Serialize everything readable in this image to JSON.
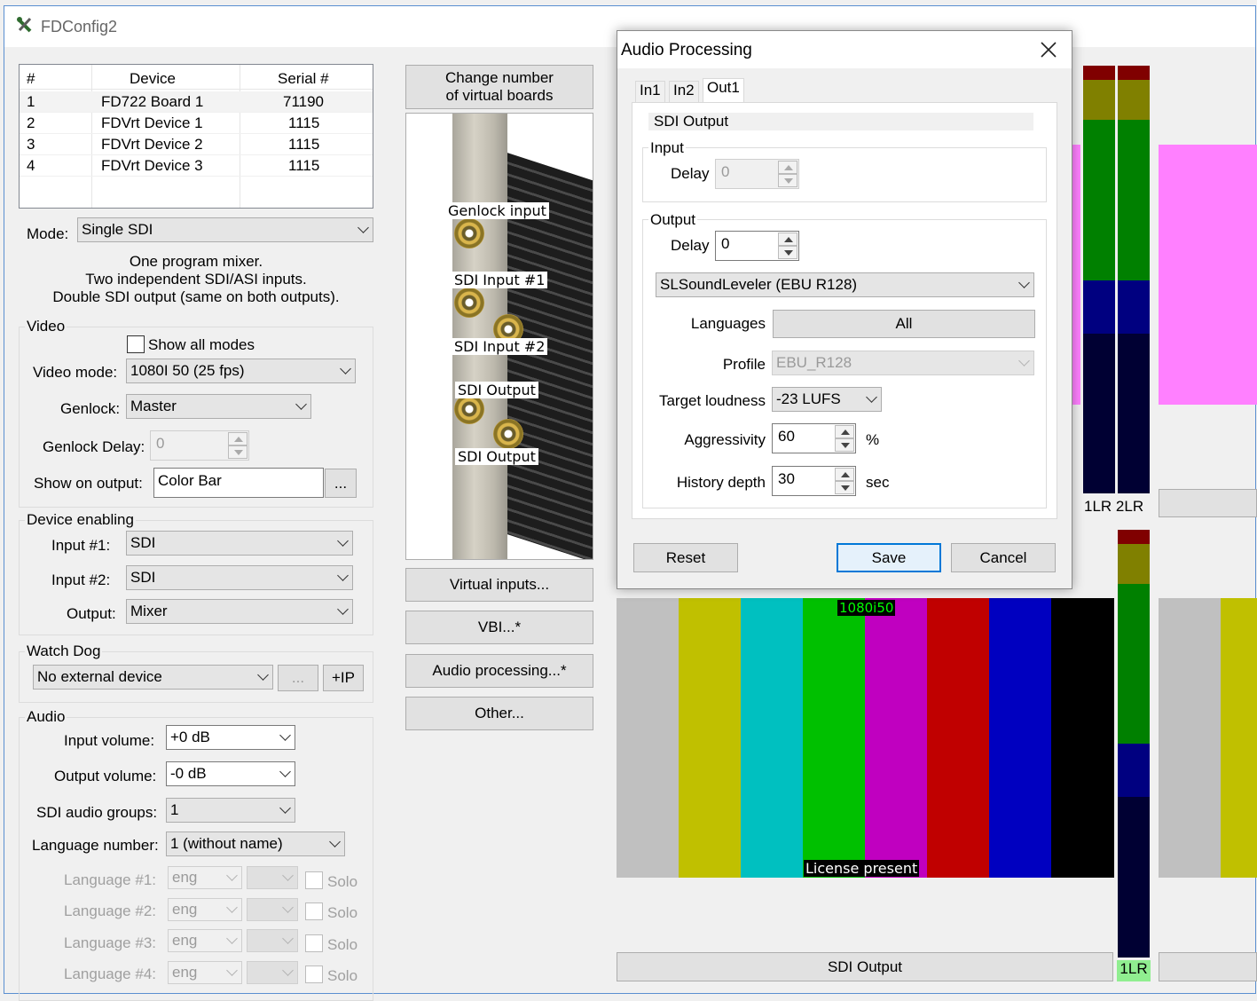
{
  "window": {
    "title": "FDConfig2"
  },
  "device_table": {
    "headers": [
      "#",
      "Device",
      "Serial #"
    ],
    "rows": [
      [
        "1",
        "FD722 Board 1",
        "71190"
      ],
      [
        "2",
        "FDVrt Device 1",
        "1115"
      ],
      [
        "3",
        "FDVrt Device 2",
        "1115"
      ],
      [
        "4",
        "FDVrt Device 3",
        "1115"
      ]
    ]
  },
  "mode": {
    "label": "Mode:",
    "value": "Single SDI",
    "desc1": "One program mixer.",
    "desc2": "Two independent SDI/ASI inputs.",
    "desc3": "Double SDI output (same on both outputs)."
  },
  "video": {
    "group": "Video",
    "show_all_modes": "Show all modes",
    "video_mode_label": "Video mode:",
    "video_mode": "1080I 50 (25 fps)",
    "genlock_label": "Genlock:",
    "genlock": "Master",
    "genlock_delay_label": "Genlock Delay:",
    "genlock_delay": "0",
    "show_on_output_label": "Show on output:",
    "show_on_output": "Color Bar",
    "browse": "..."
  },
  "device_enabling": {
    "group": "Device enabling",
    "input1_label": "Input #1:",
    "input1": "SDI",
    "input2_label": "Input #2:",
    "input2": "SDI",
    "output_label": "Output:",
    "output": "Mixer"
  },
  "watchdog": {
    "group": "Watch Dog",
    "value": "No external device",
    "browse": "...",
    "ip": "+IP"
  },
  "audio": {
    "group": "Audio",
    "input_volume_label": "Input volume:",
    "input_volume": "+0 dB",
    "output_volume_label": "Output volume:",
    "output_volume": "-0 dB",
    "sdi_groups_label": "SDI audio groups:",
    "sdi_groups": "1",
    "language_number_label": "Language number:",
    "language_number": "1 (without name)",
    "languages": [
      {
        "label": "Language #1:",
        "value": "eng",
        "solo": "Solo"
      },
      {
        "label": "Language #2:",
        "value": "eng",
        "solo": "Solo"
      },
      {
        "label": "Language #3:",
        "value": "eng",
        "solo": "Solo"
      },
      {
        "label": "Language #4:",
        "value": "eng",
        "solo": "Solo"
      }
    ]
  },
  "middle": {
    "change_boards": "Change number\nof virtual boards",
    "board_labels": [
      "Genlock input",
      "SDI Input #1",
      "SDI Input #2",
      "SDI Output",
      "SDI Output"
    ],
    "virtual_inputs": "Virtual inputs...",
    "vbi": "VBI...*",
    "audio_processing": "Audio processing...*",
    "other": "Other..."
  },
  "dialog": {
    "title": "Audio Processing",
    "tabs": [
      "In1",
      "In2",
      "Out1"
    ],
    "section_title": "SDI Output",
    "input_group": "Input",
    "input_delay_label": "Delay",
    "input_delay": "0",
    "output_group": "Output",
    "output_delay_label": "Delay",
    "output_delay": "0",
    "processor": "SLSoundLeveler (EBU R128)",
    "languages_label": "Languages",
    "languages_btn": "All",
    "profile_label": "Profile",
    "profile": "EBU_R128",
    "target_label": "Target loudness",
    "target": "-23 LUFS",
    "aggressivity_label": "Aggressivity",
    "aggressivity": "60",
    "aggressivity_unit": "%",
    "history_label": "History depth",
    "history": "30",
    "history_unit": "sec",
    "reset": "Reset",
    "save": "Save",
    "cancel": "Cancel"
  },
  "preview": {
    "format_badge": "1080i50",
    "license": "License present",
    "output_label": "SDI Output",
    "meter_labels_top": "1LR 2LR",
    "meter_label_bottom": "1LR"
  },
  "colors": {
    "accent": "#0078d7",
    "magenta_panel": "#ff80ff",
    "meter_navy": "#000033",
    "meter_green": "#008000",
    "meter_olive": "#808000",
    "meter_red": "#800000",
    "meter_blue": "#000080"
  }
}
